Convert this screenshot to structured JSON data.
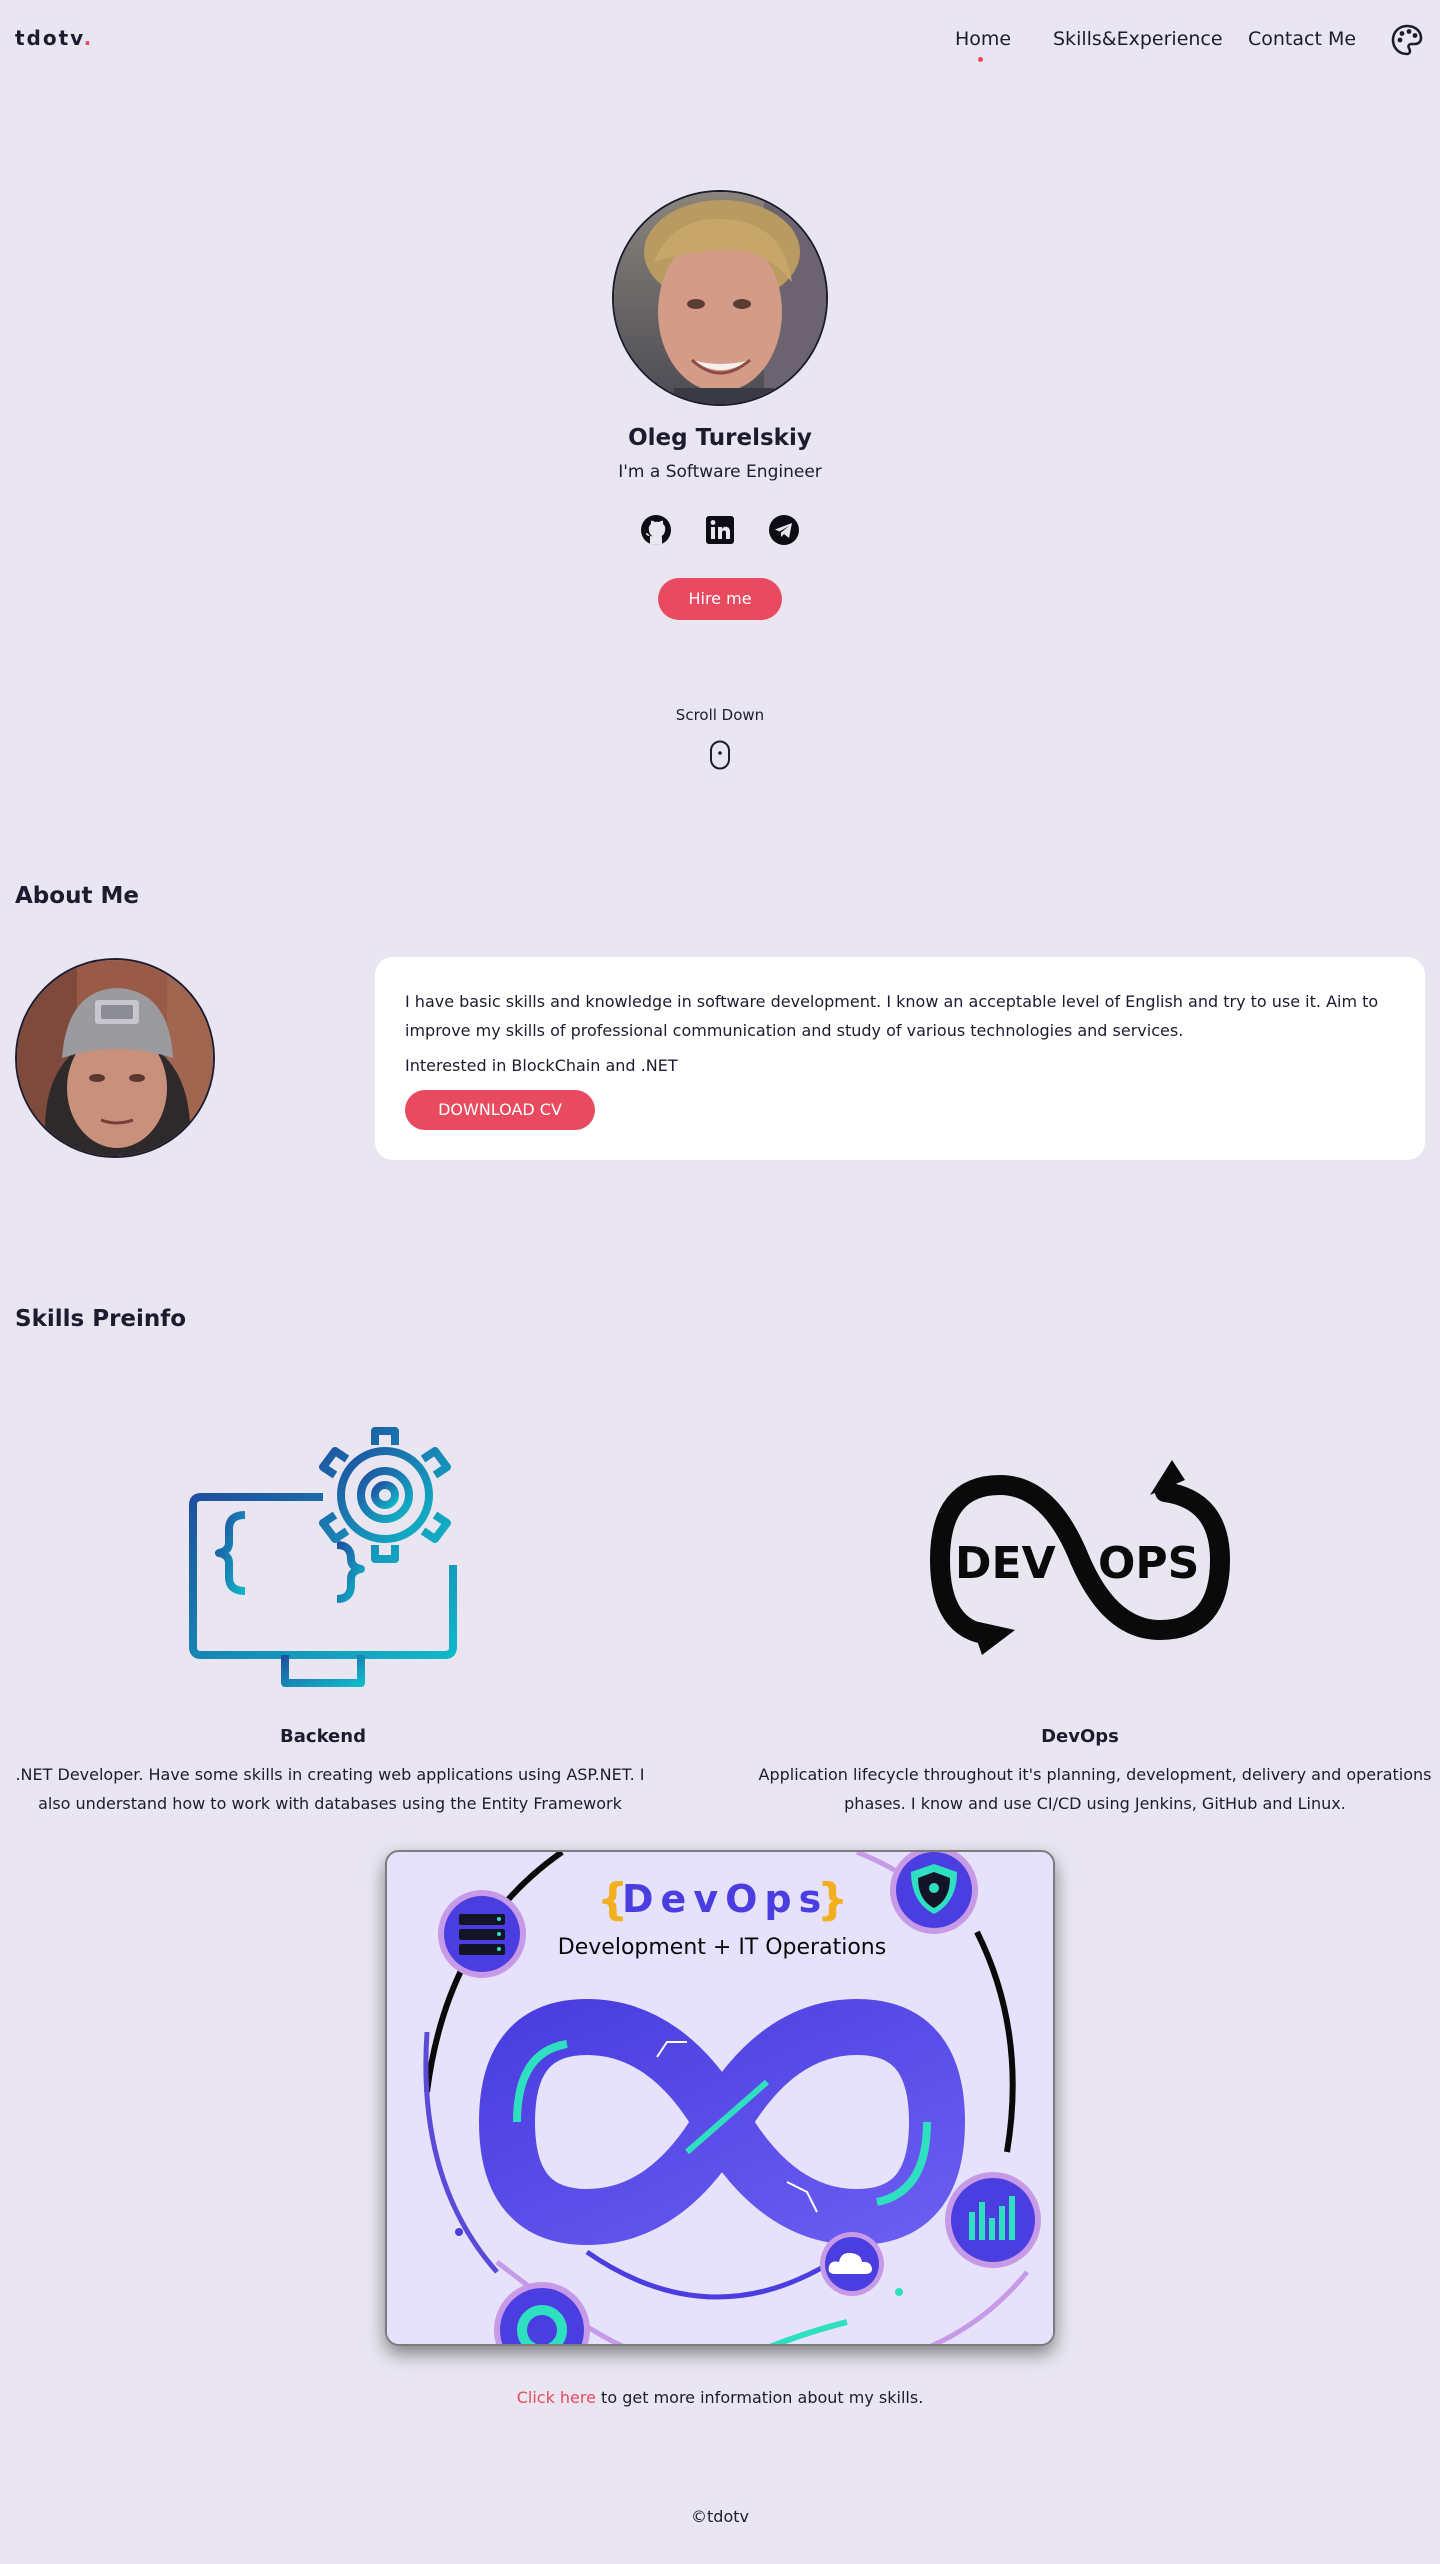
{
  "nav": {
    "logo_text": "tdotv",
    "logo_dot": ".",
    "links": [
      {
        "label": "Home"
      },
      {
        "label": "Skills&Experience"
      },
      {
        "label": "Contact Me"
      }
    ],
    "theme_icon": "palette-icon"
  },
  "hero": {
    "name": "Oleg Turelskiy",
    "role": "I'm a Software Engineer",
    "socials": [
      "github-icon",
      "linkedin-icon",
      "telegram-icon"
    ],
    "hire_label": "Hire me",
    "scroll_label": "Scroll Down"
  },
  "about": {
    "title": "About Me",
    "text": "I have basic skills and knowledge in software development. I know an acceptable level of English and try to use it. Aim to improve my skills of professional communication and study of various technologies and services.",
    "interests": "Interested in BlockChain and .NET",
    "cv_label": "DOWNLOAD CV"
  },
  "skills": {
    "title": "Skills Preinfo",
    "backend": {
      "name": "Backend",
      "desc": ".NET Developer. Have some skills in creating web applications using ASP.NET. I also understand how to work with databases using the Entity Framework"
    },
    "devops": {
      "name": "DevOps",
      "desc": "Application lifecycle throughout it's planning, development, delivery and operations phases. I know and use CI/CD using Jenkins, GitHub and Linux.",
      "icon_text_left": "DEV",
      "icon_text_right": "OPS"
    },
    "poster": {
      "brace_open": "{",
      "title": "DevOps",
      "brace_close": "}",
      "subtitle": "Development + IT Operations"
    },
    "more_link": "Click here",
    "more_rest": " to get more information about my skills."
  },
  "footer": {
    "text": "©tdotv"
  },
  "colors": {
    "background": "#e9e6f2",
    "accent": "#e84a5f",
    "text": "#1d1b2e"
  }
}
